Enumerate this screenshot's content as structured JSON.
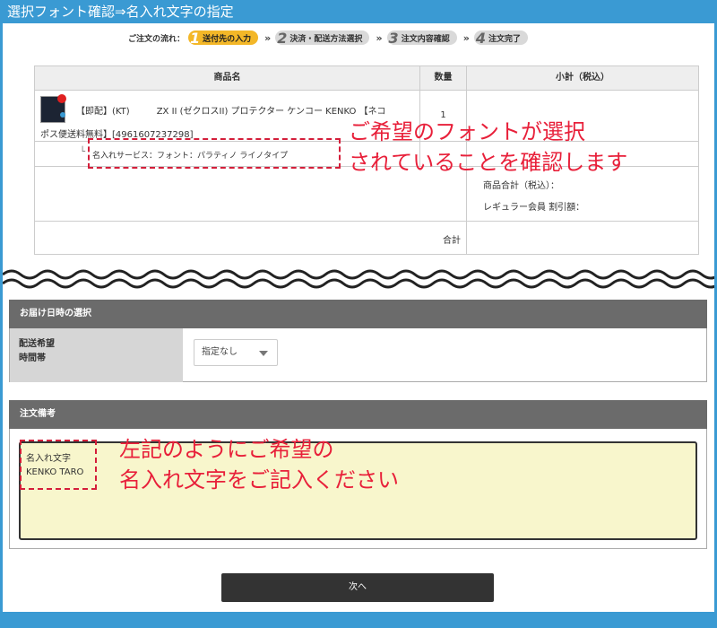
{
  "title": "選択フォント確認⇒名入れ文字の指定",
  "flow": {
    "label": "ご注文の流れ：",
    "steps": [
      {
        "num": "1",
        "label": "送付先の入力"
      },
      {
        "num": "2",
        "label": "決済・配送方法選択"
      },
      {
        "num": "3",
        "label": "注文内容確認"
      },
      {
        "num": "4",
        "label": "注文完了"
      }
    ],
    "separator": "»"
  },
  "product_table": {
    "headers": [
      "商品名",
      "数量",
      "小計（税込）"
    ],
    "item_line1": "【即配】(KT)　　　ZX II (ゼクロスII) プロテクター ケンコー KENKO 【ネコ",
    "item_line2": "ポス便送料無料】[4961607237298]",
    "quantity": "1",
    "option_prefix": "└",
    "option_text": "名入れサービス：フォント：パラティノ ライノタイプ",
    "subtotal_label": "商品合計（税込）：",
    "discount_label": "レギュラー会員 割引額：",
    "total_label": "合計"
  },
  "annotations": {
    "font_line1": "ご希望のフォントが選択",
    "font_line2": "されていることを確認します",
    "memo_line1": "左記のようにご希望の",
    "memo_line2": "名入れ文字をご記入ください"
  },
  "delivery": {
    "section_title": "お届け日時の選択",
    "time_label_line1": "配送希望",
    "time_label_line2": "時間帯",
    "time_value": "指定なし"
  },
  "notes": {
    "section_title": "注文備考",
    "memo_line1": "名入れ文字",
    "memo_line2": "KENKO TARO"
  },
  "next_button": "次へ",
  "colors": {
    "title_bar": "#3a9ad3",
    "accent_step": "#f3b728",
    "annotation": "#e8203a",
    "memo_bg": "#f8f6cc"
  }
}
